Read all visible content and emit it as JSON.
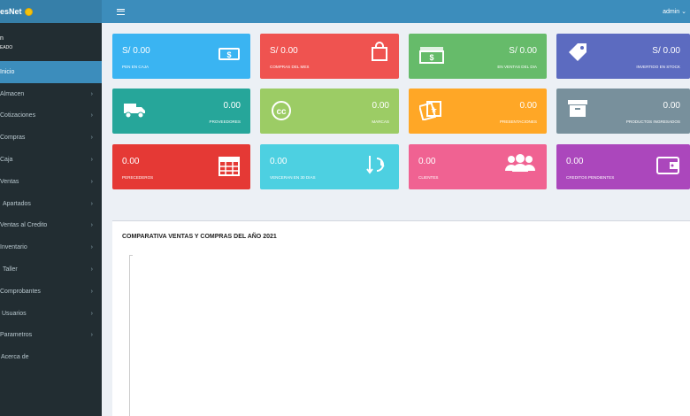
{
  "app": {
    "brand": "esNet"
  },
  "header": {
    "user": "admin ⌄"
  },
  "user_panel": {
    "name": "n",
    "role": "EADO"
  },
  "sidebar": {
    "items": [
      {
        "label": "Inicio",
        "chevron": ""
      },
      {
        "label": "Almacen",
        "chevron": "›"
      },
      {
        "label": "Cotizaciones",
        "chevron": "›"
      },
      {
        "label": "Compras",
        "chevron": "›"
      },
      {
        "label": "Caja",
        "chevron": "›"
      },
      {
        "label": "Ventas",
        "chevron": "›"
      },
      {
        "label": "Apartados",
        "chevron": "›"
      },
      {
        "label": "Ventas al Credito",
        "chevron": "›"
      },
      {
        "label": "Inventario",
        "chevron": "›"
      },
      {
        "label": "Taller",
        "chevron": "›"
      },
      {
        "label": "Comprobantes",
        "chevron": "›"
      },
      {
        "label": "Usuarios",
        "chevron": "›"
      },
      {
        "label": "Parametros",
        "chevron": "›"
      },
      {
        "label": "Acerca de",
        "chevron": ""
      }
    ]
  },
  "boxes": [
    {
      "value": "S/ 0.00",
      "label": "PEN EN CAJA",
      "color": "#3ab4f2",
      "icon": "money-icon"
    },
    {
      "value": "S/ 0.00",
      "label": "COMPRAS DEL MES",
      "color": "#ef5350",
      "icon": "shopping-bag-icon"
    },
    {
      "value": "S/ 0.00",
      "label": "EN VENTAS DEL DIA",
      "color": "#66bb6a",
      "icon": "money-stack-icon"
    },
    {
      "value": "S/ 0.00",
      "label": "INVERTIDO EN STOCK",
      "color": "#5c6bc0",
      "icon": "tag-icon"
    },
    {
      "value": "0.00",
      "label": "PROVEEDORES",
      "color": "#26a69a",
      "icon": "truck-icon"
    },
    {
      "value": "0.00",
      "label": "MARCAS",
      "color": "#9ccc65",
      "icon": "copyright-icon"
    },
    {
      "value": "0.00",
      "label": "PRESENTACIONES",
      "color": "#ffa726",
      "icon": "photos-icon"
    },
    {
      "value": "0.00",
      "label": "PRODUCTOS INGRESADOS",
      "color": "#78909c",
      "icon": "archive-icon"
    },
    {
      "value": "0.00",
      "label": "PERECEDEROS",
      "color": "#e53935",
      "icon": "calendar-icon"
    },
    {
      "value": "0.00",
      "label": "VENCERAN EN 30 DIAS",
      "color": "#4dd0e1",
      "icon": "history-icon"
    },
    {
      "value": "0.00",
      "label": "CLIENTES",
      "color": "#f06292",
      "icon": "users-icon"
    },
    {
      "value": "0.00",
      "label": "CREDITOS PENDIENTES",
      "color": "#ab47bc",
      "icon": "wallet-icon"
    }
  ],
  "chart": {
    "title": "COMPARATIVA VENTAS Y COMPRAS DEL AÑO 2021"
  }
}
